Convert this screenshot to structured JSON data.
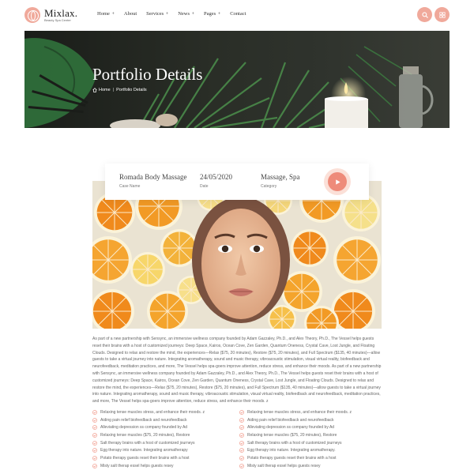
{
  "brand": {
    "name": "Mixlax.",
    "tagline": "Beauty Spa Center"
  },
  "nav": [
    {
      "label": "Home",
      "plus": "+"
    },
    {
      "label": "About",
      "plus": ""
    },
    {
      "label": "Services",
      "plus": "+"
    },
    {
      "label": "News",
      "plus": "+"
    },
    {
      "label": "Pages",
      "plus": "+"
    },
    {
      "label": "Contact",
      "plus": ""
    }
  ],
  "header_icons": [
    "search-icon",
    "grid-icon"
  ],
  "banner": {
    "title": "Portfolio Details",
    "breadcrumb": {
      "home": "Home",
      "separator": "|",
      "current": "Portfolio Details"
    }
  },
  "info": [
    {
      "value": "Romada Body Massage",
      "label": "Case Name"
    },
    {
      "value": "24/05/2020",
      "label": "Date"
    },
    {
      "value": "Massage, Spa",
      "label": "Category"
    }
  ],
  "description": "As part of a new partnership with Sensync, an immersive wellness company founded by Adam Gazzaley, Ph.D., and Alex Theory, Ph.D., The Vessel helps guests reset their brains with a host of customized journeys: Deep Space, Kairos, Ocean Cove, Zen Garden, Quantum Oneness, Crystal Cave, Lost Jungle, and Floating Clouds. Designed to relax and restore the mind, the experiences—Relax ($75, 20 minutes), Restore ($75, 20 minutes), and Full Spectrum ($135, 40 minutes)—allow guests to take a virtual journey into nature. Integrating aromatherapy, sound and music therapy, vibroacoustic stimulation, visual virtual reality, biofeedback and neurofeedback, meditation practices, and more, The Vessel helps spa-goers improve attention, reduce stress, and enhance their moods. As part of a new partnership with Sensync, an immersive wellness company founded by Adam Gazzaley, Ph.D., and Alex Theory, Ph.D., The Vessel helps guests reset their brains with a host of customized journeys: Deep Space, Kairos, Ocean Cove, Zen Garden, Quantum Oneness, Crystal Cave, Lost Jungle, and Floating Clouds. Designed to relax and restore the mind, the experiences—Relax ($75, 20 minutes), Restore ($75, 20 minutes), and Full Spectrum ($135, 40 minutes)—allow guests to take a virtual journey into nature. Integrating aromatherapy, sound and music therapy, vibroacoustic stimulation, visual virtual reality, biofeedback and neurofeedback, meditation practices, and more, The Vessel helps spa-goers improve attention, reduce stress, and enhance their moods. z",
  "list_left": [
    "Relaxing tense muscles stress, and enhance their moods. z",
    "Aiding pain relief biofeedback and neurofeedback",
    "Alleviating depression ss company founded by Ad",
    "Relaxing tense muscles ($75, 20 minutes), Restore",
    "Salt therapy brains with a host of customized journeys",
    "Egg therapy into nature. Integrating aromatherapy",
    "Potato therapy guests reset their brains with a host",
    "Misty salt therap essel helps guests resey"
  ],
  "list_right": [
    "Relaxing tense muscles stress, and enhance their moods. z",
    "Aiding pain relief biofeedback and neurofeedback",
    "Alleviating depression ss company founded by Ad",
    "Relaxing tense muscles ($75, 20 minutes), Restore",
    "Salt therapy brains with a host of customized journeys",
    "Egg therapy into nature. Integrating aromatherapy.",
    "Potato therapy guests reset their brains with a host",
    "Misty salt therap essel helps guests resey"
  ],
  "colors": {
    "accent": "#f0a99b",
    "accent_dark": "#ee8b7a",
    "banner_bg": "#2a2e27",
    "text": "#555555"
  }
}
